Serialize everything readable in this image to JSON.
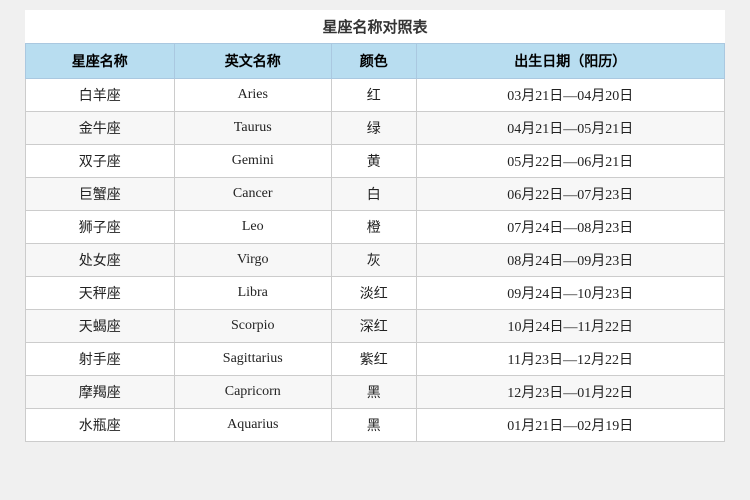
{
  "title": "星座名称对照表",
  "headers": [
    "星座名称",
    "英文名称",
    "颜色",
    "出生日期（阳历）"
  ],
  "rows": [
    {
      "chinese": "白羊座",
      "english": "Aries",
      "color": "红",
      "date": "03月21日—04月20日"
    },
    {
      "chinese": "金牛座",
      "english": "Taurus",
      "color": "绿",
      "date": "04月21日—05月21日"
    },
    {
      "chinese": "双子座",
      "english": "Gemini",
      "color": "黄",
      "date": "05月22日—06月21日"
    },
    {
      "chinese": "巨蟹座",
      "english": "Cancer",
      "color": "白",
      "date": "06月22日—07月23日"
    },
    {
      "chinese": "狮子座",
      "english": "Leo",
      "color": "橙",
      "date": "07月24日—08月23日"
    },
    {
      "chinese": "处女座",
      "english": "Virgo",
      "color": "灰",
      "date": "08月24日—09月23日"
    },
    {
      "chinese": "天秤座",
      "english": "Libra",
      "color": "淡红",
      "date": "09月24日—10月23日"
    },
    {
      "chinese": "天蝎座",
      "english": "Scorpio",
      "color": "深红",
      "date": "10月24日—11月22日"
    },
    {
      "chinese": "射手座",
      "english": "Sagittarius",
      "color": "紫红",
      "date": "11月23日—12月22日"
    },
    {
      "chinese": "摩羯座",
      "english": "Capricorn",
      "color": "黑",
      "date": "12月23日—01月22日"
    },
    {
      "chinese": "水瓶座",
      "english": "Aquarius",
      "color": "黑",
      "date": "01月21日—02月19日"
    }
  ]
}
